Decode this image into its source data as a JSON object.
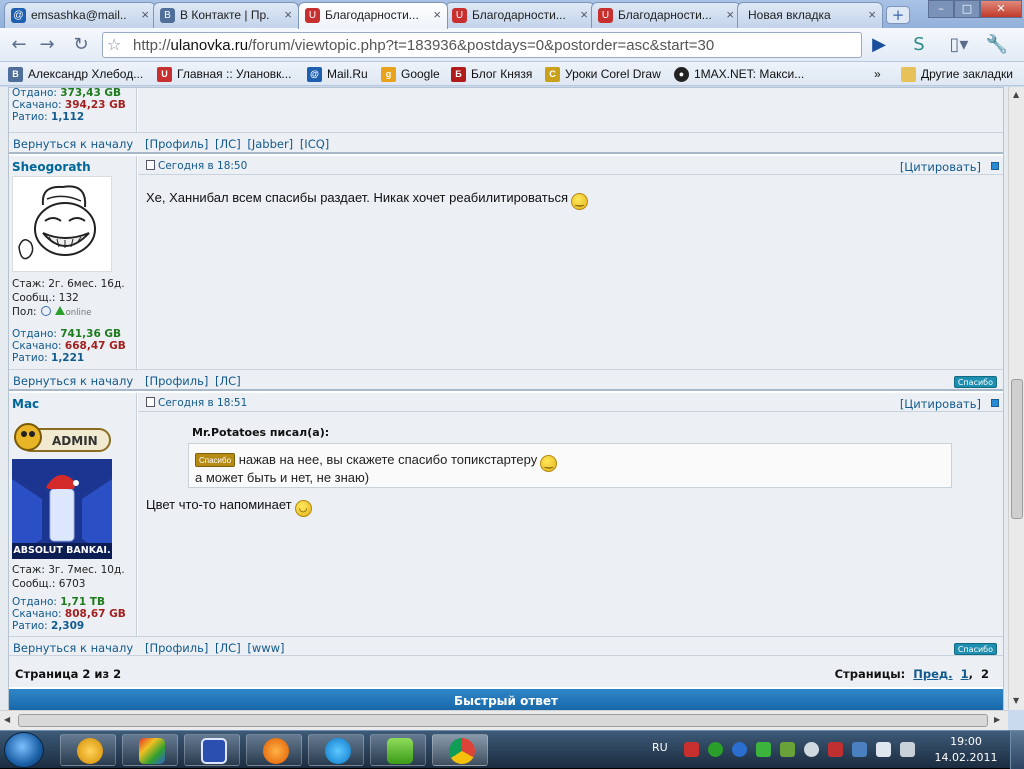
{
  "browser": {
    "tabs": [
      {
        "title": "emsashka@mail....",
        "icon": "mail-at-icon",
        "color": "#1f5fb0",
        "active": false
      },
      {
        "title": "В Контакте | Пр...",
        "icon": "vk-icon",
        "color": "#4f6f9a",
        "active": false
      },
      {
        "title": "Благодарности...",
        "icon": "ulanovka-icon",
        "color": "#c83030",
        "active": true
      },
      {
        "title": "Благодарности...",
        "icon": "ulanovka-icon",
        "color": "#c83030",
        "active": false
      },
      {
        "title": "Благодарности...",
        "icon": "ulanovka-icon",
        "color": "#c83030",
        "active": false
      },
      {
        "title": "Новая вкладка",
        "icon": "none",
        "color": "#ffffff",
        "active": false
      }
    ],
    "url_prefix": "http://",
    "url_host": "ulanovka.ru",
    "url_path": "/forum/viewtopic.php?t=183936&postdays=0&postorder=asc&start=30",
    "bookmarks": [
      {
        "label": "Александр Хлебод...",
        "icon": "vk-icon",
        "color": "#4f6f9a"
      },
      {
        "label": "Главная :: Улановк...",
        "icon": "ulanovka-icon",
        "color": "#c83030"
      },
      {
        "label": "Mail.Ru",
        "icon": "mail-at-icon",
        "color": "#1f5fb0"
      },
      {
        "label": "Google",
        "icon": "google-icon",
        "color": "#e8a21b"
      },
      {
        "label": "Блог Князя",
        "icon": "blog-icon",
        "color": "#b01b1b"
      },
      {
        "label": "Уроки Corel Draw",
        "icon": "corel-icon",
        "color": "#c9a11a"
      },
      {
        "label": "1MAX.NET: Макси...",
        "icon": "max-icon",
        "color": "#222222"
      }
    ],
    "bookmarks_overflow": "»",
    "other_bookmarks": "Другие закладки"
  },
  "forum": {
    "prev_post": {
      "uploaded_label": "Отдано:",
      "uploaded": "373,43 GB",
      "downloaded_label": "Скачано:",
      "downloaded": "394,23 GB",
      "ratio_label": "Ратио:",
      "ratio": "1,112"
    },
    "back_to_top": "Вернуться к началу",
    "links_1": "[Профиль]  [ЛС]  [Jabber]  [ICQ]",
    "posts": [
      {
        "author": "Sheogorath",
        "date": "Сегодня в 18:50",
        "quote_label": "[Цитировать]",
        "text": "Хе, Ханнибал всем спасибы раздает. Никак хочет реабилитироваться",
        "stazh": "Стаж: 2г. 6мес. 16д.",
        "posts": "Сообщ.: 132",
        "gender_label": "Пол:",
        "online": "online",
        "uploaded_label": "Отдано:",
        "uploaded": "741,36 GB",
        "downloaded_label": "Скачано:",
        "downloaded": "668,47 GB",
        "ratio_label": "Ратио:",
        "ratio": "1,221",
        "links": "[Профиль]  [ЛС]",
        "thanks": "Спасибо"
      },
      {
        "author": "Mac",
        "rank": "ADMIN",
        "avatar_caption": "ABSOLUT BANKAI.",
        "date": "Сегодня в 18:51",
        "quote_label": "[Цитировать]",
        "quote_author": "Mr.Potatoes писал(а):",
        "quote_thanks": "Спасибо",
        "quote_line1": "нажав на нее, вы скажете спасибо топикстартеру",
        "quote_line2": "а может быть и нет, не знаю)",
        "text": "Цвет что-то напоминает",
        "stazh": "Стаж: 3г. 7мес. 10д.",
        "posts": "Сообщ.: 6703",
        "uploaded_label": "Отдано:",
        "uploaded": "1,71 TB",
        "downloaded_label": "Скачано:",
        "downloaded": "808,67 GB",
        "ratio_label": "Ратио:",
        "ratio": "2,309",
        "links": "[Профиль]  [ЛС]  [www]",
        "thanks": "Спасибо"
      }
    ],
    "pager_left": "Страница 2 из 2",
    "pager_label": "Страницы:",
    "pager_prev": "Пред.",
    "pager_p1": "1",
    "pager_sep": ",",
    "pager_current": "2",
    "quick_reply": "Быстрый ответ"
  },
  "taskbar": {
    "lang": "RU",
    "time": "19:00",
    "date": "14.02.2011"
  }
}
